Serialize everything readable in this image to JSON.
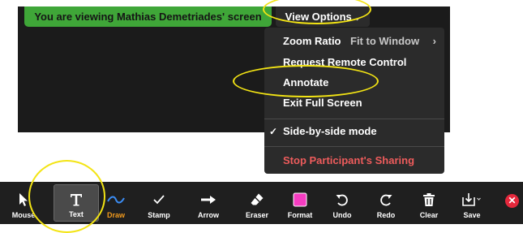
{
  "banner": {
    "text": "You are viewing Mathias Demetriades' screen"
  },
  "view_options": {
    "label": "View Options",
    "chevron": "⌄"
  },
  "menu": {
    "zoom_ratio": {
      "label": "Zoom Ratio",
      "value": "Fit to Window",
      "arrow": "›"
    },
    "request_remote_control": "Request Remote Control",
    "annotate": "Annotate",
    "exit_full_screen": "Exit Full Screen",
    "side_by_side": {
      "label": "Side-by-side mode",
      "checked": true,
      "check": "✓"
    },
    "stop_sharing": "Stop Participant's Sharing"
  },
  "toolbar": {
    "tools": [
      {
        "label": "Mouse",
        "icon": "mouse-pointer-icon"
      },
      {
        "label": "Text",
        "icon": "text-t-icon"
      },
      {
        "label": "Draw",
        "icon": "draw-wave-icon"
      },
      {
        "label": "Stamp",
        "icon": "checkmark-stamp-icon"
      },
      {
        "label": "Arrow",
        "icon": "arrow-right-icon"
      },
      {
        "label": "Eraser",
        "icon": "eraser-icon"
      },
      {
        "label": "Format",
        "icon": "format-color-icon"
      },
      {
        "label": "Undo",
        "icon": "undo-icon"
      },
      {
        "label": "Redo",
        "icon": "redo-icon"
      },
      {
        "label": "Clear",
        "icon": "trash-icon"
      },
      {
        "label": "Save",
        "icon": "save-download-icon"
      }
    ],
    "close": "✕"
  },
  "colors": {
    "banner_green": "#3fa638",
    "highlight_yellow": "#f3e414",
    "format_swatch": "#f53cc1",
    "draw_accent": "#f39b1d",
    "stop_red": "#ee5c5c",
    "close_red": "#e5283c"
  }
}
